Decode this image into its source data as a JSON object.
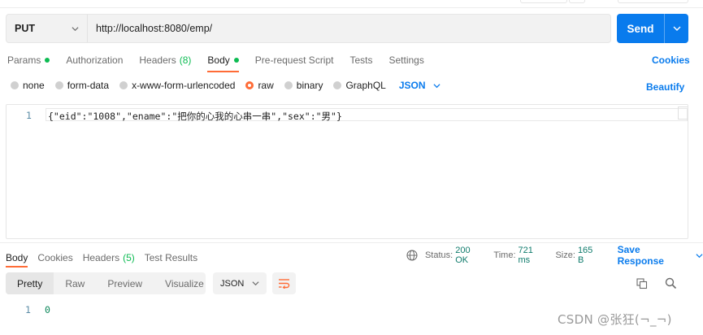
{
  "request": {
    "method": "PUT",
    "url": "http://localhost:8080/emp/",
    "send_label": "Send"
  },
  "request_tabs": [
    {
      "label": "Params",
      "dot": true
    },
    {
      "label": "Authorization"
    },
    {
      "label": "Headers",
      "count": "(8)"
    },
    {
      "label": "Body",
      "dot": true,
      "active": true
    },
    {
      "label": "Pre-request Script"
    },
    {
      "label": "Tests"
    },
    {
      "label": "Settings"
    }
  ],
  "cookies_label": "Cookies",
  "body_types": {
    "options": [
      "none",
      "form-data",
      "x-www-form-urlencoded",
      "raw",
      "binary",
      "GraphQL"
    ],
    "selected": "raw",
    "format": "JSON",
    "beautify_label": "Beautify"
  },
  "editor": {
    "line_number": "1",
    "code": "{\"eid\":\"1008\",\"ename\":\"把你的心我的心串一串\",\"sex\":\"男\"}"
  },
  "response_tabs": [
    {
      "label": "Body",
      "active": true
    },
    {
      "label": "Cookies"
    },
    {
      "label": "Headers",
      "count": "(5)"
    },
    {
      "label": "Test Results"
    }
  ],
  "response_status": {
    "status_label": "Status:",
    "status_value": "200 OK",
    "time_label": "Time:",
    "time_value": "721 ms",
    "size_label": "Size:",
    "size_value": "165 B",
    "save_label": "Save Response"
  },
  "response_view": {
    "modes": [
      "Pretty",
      "Raw",
      "Preview",
      "Visualize"
    ],
    "selected": "Pretty",
    "format": "JSON"
  },
  "response_body": {
    "line_number": "1",
    "value": "0"
  },
  "watermark": "CSDN @张狂(¬_¬)",
  "colors": {
    "accent": "#ff6c37",
    "link": "#097bed",
    "success": "#0cbb52"
  }
}
